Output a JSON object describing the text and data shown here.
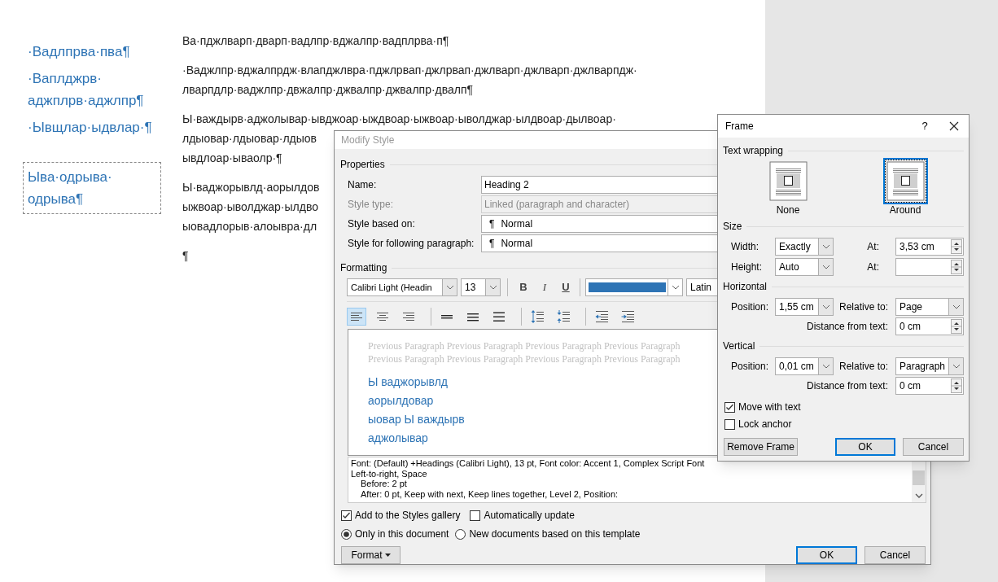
{
  "document": {
    "side_headings": [
      {
        "lines": [
          "·Вадлпрва·пва¶"
        ],
        "framed": false
      },
      {
        "lines": [
          "·Ваплджрв·",
          "аджплрв·аджлпр¶"
        ],
        "framed": false
      },
      {
        "lines": [
          "·Ывщлар·ыдвлар·¶"
        ],
        "framed": false
      },
      {
        "lines": [
          "Ыва·одрыва·",
          "одрыва¶"
        ],
        "framed": true
      }
    ],
    "paragraphs": [
      {
        "lines": [
          "Ва·пджлварп·дварп·вадлпр·вджалпр·вадплрва·п¶"
        ]
      },
      {
        "lines": [
          "·Ваджлпр·вджалпрдж·влапджлвра·пджлрвап·джлрвап·джлварп·джлварп·джлварпдж·",
          "лварпдлр·ваджлпр·двжалпр·джвалпр·джвалпр·двалп¶"
        ]
      },
      {
        "lines": [
          "Ы·важдырв·аджолывар·ывджоар·ыждвоар·ыжвоар·ыволджар·ылдвоар·дылвоар·",
          "лдыовар·лдыовар·лдыов",
          "ывдлоар·ываолр·¶"
        ]
      },
      {
        "lines": [
          "Ы·ваджорывлд·аорылдов",
          "ыжвоар·ыволджар·ылдво",
          "ыовадлорыв·алоывра·дл"
        ]
      },
      {
        "lines": [
          "¶"
        ]
      }
    ]
  },
  "modify_style": {
    "title": "Modify Style",
    "properties_heading": "Properties",
    "properties": [
      {
        "label": "Name:",
        "value": "Heading 2",
        "disabled": false
      },
      {
        "label": "Style type:",
        "value": "Linked (paragraph and character)",
        "disabled": true
      },
      {
        "label": "Style based on:",
        "value": "Normal",
        "mark": "¶",
        "disabled": false
      },
      {
        "label": "Style for following paragraph:",
        "value": "Normal",
        "mark": "¶",
        "disabled": false
      }
    ],
    "formatting_heading": "Formatting",
    "font": "Calibri Light (Headin",
    "size": "13",
    "text_buttons": [
      {
        "label": "B",
        "kind": "bold",
        "selected": false
      },
      {
        "label": "I",
        "kind": "italic",
        "selected": false
      },
      {
        "label": "U",
        "kind": "underline",
        "selected": false
      }
    ],
    "script": "Latin",
    "paragraph_buttons": [
      {
        "kind": "align-left",
        "selected": true
      },
      {
        "kind": "align-center",
        "selected": false
      },
      {
        "kind": "align-right",
        "selected": false
      },
      {
        "kind": "single-spacing",
        "selected": false
      },
      {
        "kind": "one-half-spacing",
        "selected": false
      },
      {
        "kind": "double-spacing",
        "selected": false
      },
      {
        "kind": "more-spacing",
        "selected": false
      },
      {
        "kind": "less-spacing",
        "selected": false
      },
      {
        "kind": "outdent",
        "selected": false
      },
      {
        "kind": "indent",
        "selected": false
      }
    ],
    "preview": {
      "previous_lines": [
        "Previous Paragraph Previous Paragraph Previous Paragraph Previous Paragraph",
        "Previous Paragraph Previous Paragraph Previous Paragraph Previous Paragraph"
      ],
      "sample_lines": [
        "Ы ваджорывлд",
        "аорылдовар",
        "ыовар Ы важдырв",
        "аджолывар"
      ]
    },
    "description": [
      "Font: (Default) +Headings (Calibri Light), 13 pt, Font color: Accent 1, Complex Script Font",
      "Left-to-right, Space",
      "Before:  2 pt",
      "After:  0 pt, Keep with next, Keep lines together, Level 2, Position:"
    ],
    "checkboxes": [
      {
        "label": "Add to the Styles gallery",
        "checked": true
      },
      {
        "label": "Automatically update",
        "checked": false
      }
    ],
    "radios": [
      {
        "label": "Only in this document",
        "selected": true
      },
      {
        "label": "New documents based on this template",
        "selected": false
      }
    ],
    "format_button": "Format",
    "ok": "OK",
    "cancel": "Cancel"
  },
  "frame": {
    "title": "Frame",
    "help": "?",
    "wrapping_heading": "Text wrapping",
    "wrapping": [
      {
        "label": "None",
        "selected": false
      },
      {
        "label": "Around",
        "selected": true
      }
    ],
    "size_heading": "Size",
    "size_rows": [
      {
        "label": "Width:",
        "value": "Exactly",
        "at_label": "At:",
        "at_value": "3,53 cm"
      },
      {
        "label": "Height:",
        "value": "Auto",
        "at_label": "At:",
        "at_value": ""
      }
    ],
    "horizontal_heading": "Horizontal",
    "horizontal": {
      "position_label": "Position:",
      "position": "1,55 cm",
      "relative_label": "Relative to:",
      "relative": "Page",
      "distance_label": "Distance from text:",
      "distance": "0 cm"
    },
    "vertical_heading": "Vertical",
    "vertical": {
      "position_label": "Position:",
      "position": "0,01 cm",
      "relative_label": "Relative to:",
      "relative": "Paragraph",
      "distance_label": "Distance from text:",
      "distance": "0 cm"
    },
    "checkboxes": [
      {
        "label": "Move with text",
        "checked": true
      },
      {
        "label": "Lock anchor",
        "checked": false
      }
    ],
    "remove_button": "Remove Frame",
    "ok": "OK",
    "cancel": "Cancel"
  }
}
